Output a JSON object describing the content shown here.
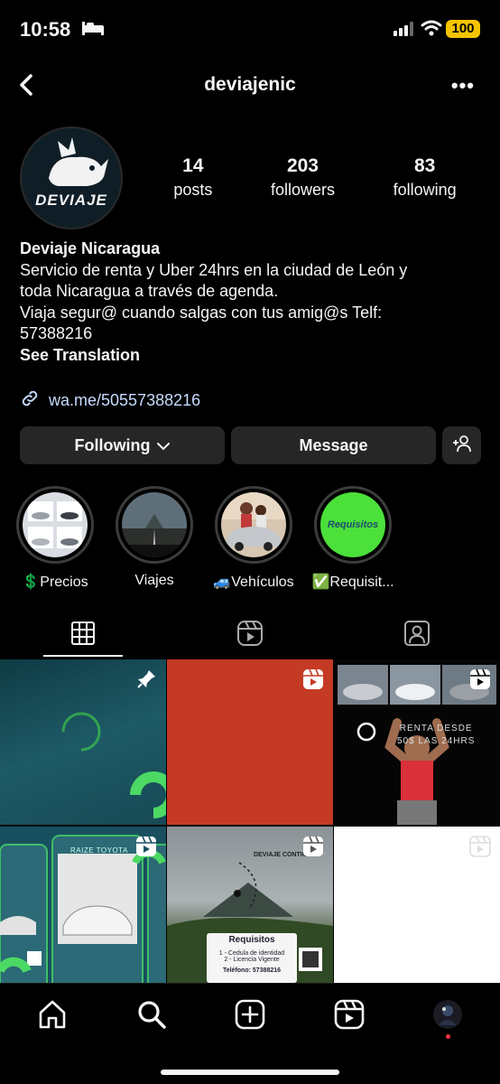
{
  "status": {
    "time": "10:58",
    "battery": "100"
  },
  "header": {
    "username": "deviajenic",
    "more": "•••"
  },
  "stats": [
    {
      "num": "14",
      "label": "posts"
    },
    {
      "num": "203",
      "label": "followers"
    },
    {
      "num": "83",
      "label": "following"
    }
  ],
  "avatar": {
    "text": "DEVIAJE"
  },
  "bio": {
    "name": "Deviaje Nicaragua",
    "lines": [
      "Servicio de renta y Uber 24hrs en la ciudad de León y",
      "toda Nicaragua a través de agenda.",
      "Viaja segur@ cuando salgas con tus amig@s Telf:",
      "57388216"
    ],
    "see_translation": "See Translation",
    "link": "wa.me/50557388216"
  },
  "buttons": {
    "following": "Following",
    "message": "Message"
  },
  "highlights": [
    {
      "label": "💲Precios"
    },
    {
      "label": "Viajes"
    },
    {
      "label": "🚙Vehículos"
    },
    {
      "label": "✅Requisit..."
    }
  ],
  "highlight_requisitos_text": "Requisitos",
  "posts": {
    "post3_text": [
      "RENTA DESDE",
      "50$ LAS 24HRS"
    ],
    "post4_text": "RAIZE TOYOTA",
    "post5_text": {
      "caption": "DEVIAJE CONTIGO",
      "title": "Requisitos",
      "items": [
        "1 - Cedula de identidad",
        "2 - Licencia Vigente"
      ],
      "phone": "Teléfono: 57388216"
    }
  },
  "colors": {
    "accent_green": "#4cd964",
    "link": "#c6dcff",
    "button_bg": "#262626"
  }
}
